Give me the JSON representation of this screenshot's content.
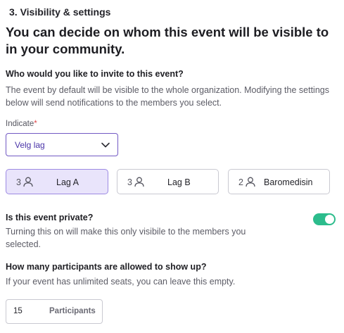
{
  "section": {
    "title": "3. Visibility & settings",
    "headline": "You can decide on whom this event will be visible to in your community."
  },
  "invite": {
    "question": "Who would you like to invite to this event?",
    "description": "The event by default will be visible to the whole organization. Modifying the settings below will send notifications to the members you select.",
    "field_label": "Indicate",
    "required_mark": "*",
    "select_value": "Velg lag",
    "groups": [
      {
        "count": "3",
        "name": "Lag A",
        "selected": true
      },
      {
        "count": "3",
        "name": "Lag B",
        "selected": false
      },
      {
        "count": "2",
        "name": "Baromedisin",
        "selected": false
      }
    ]
  },
  "privacy": {
    "question": "Is this event private?",
    "description": "Turning this on will make this only visibile to the members you selected.",
    "enabled": true
  },
  "participants": {
    "question": "How many participants are allowed to show up?",
    "description": "If your event has unlimited seats, you can leave this empty.",
    "value": "15",
    "unit": "Participants"
  },
  "colors": {
    "accent": "#4a34a8",
    "toggle_on": "#2cbc8c",
    "chip_selected_bg": "#e9e4fb",
    "required": "#e0484b"
  }
}
